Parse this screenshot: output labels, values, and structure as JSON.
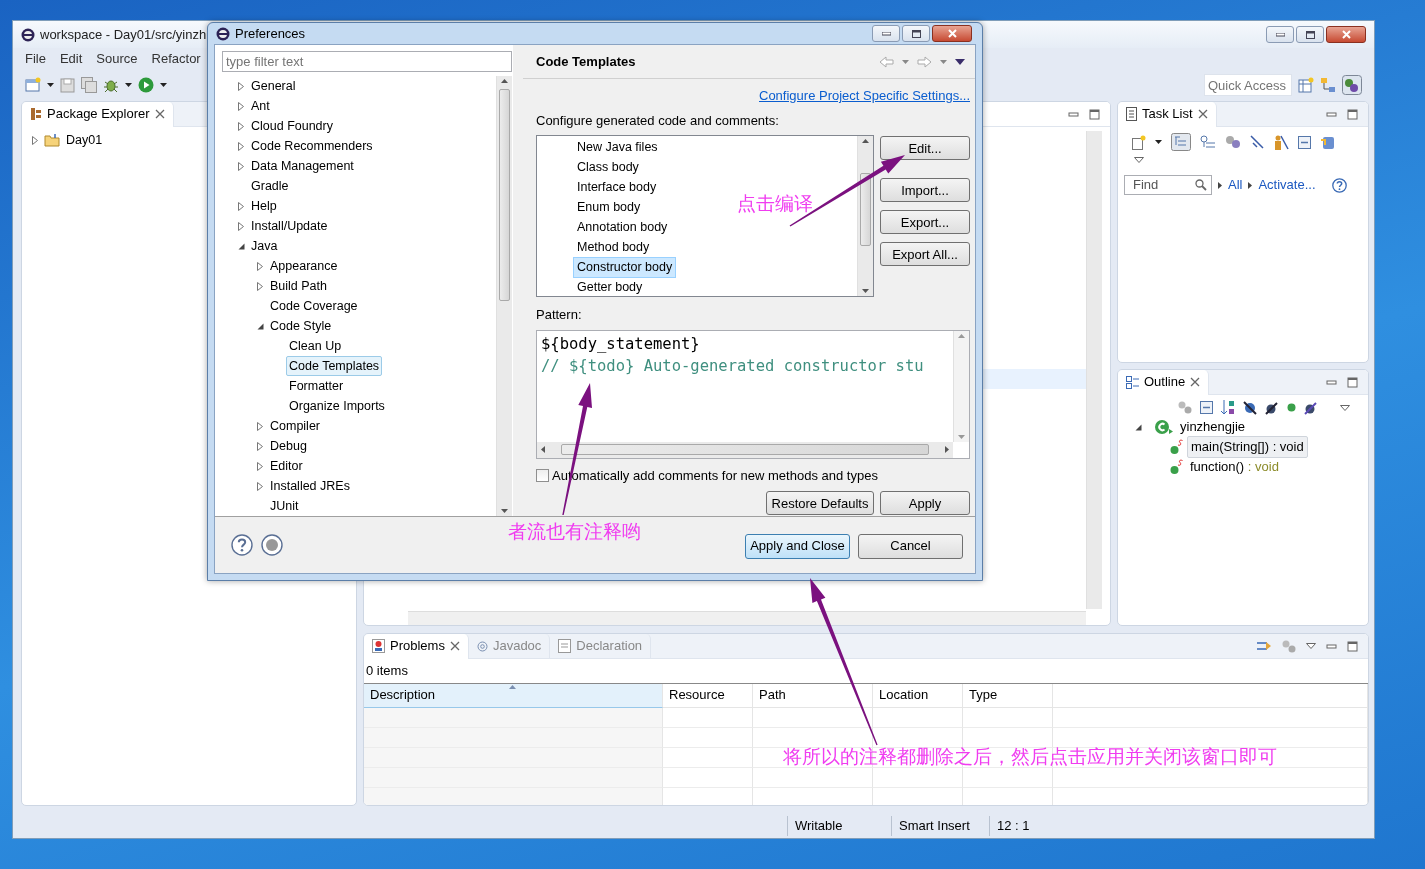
{
  "ide": {
    "title": "workspace - Day01/src/yinzh",
    "menu": [
      "File",
      "Edit",
      "Source",
      "Refactor"
    ],
    "quick_access": {
      "placeholder": "Quick Access"
    },
    "package_explorer": {
      "title": "Package Explorer",
      "items": [
        {
          "label": "Day01",
          "expanded": false
        }
      ]
    },
    "task_list": {
      "title": "Task List",
      "find": {
        "placeholder": "Find"
      },
      "filters": [
        "All",
        "Activate..."
      ]
    },
    "outline": {
      "title": "Outline",
      "items": [
        {
          "label": "yinzhengjie",
          "expanded": true,
          "selected": false,
          "children": [
            {
              "label": "main(String[])",
              "return_type": " : void",
              "selected": true
            },
            {
              "label": "function()",
              "return_type": " : void",
              "selected": false
            }
          ]
        }
      ]
    },
    "problems": {
      "tabs": [
        {
          "label": "Problems",
          "selected": true
        },
        {
          "label": "Javadoc",
          "selected": false
        },
        {
          "label": "Declaration",
          "selected": false
        }
      ],
      "summary": "0 items",
      "columns": [
        {
          "label": "Description",
          "sorted": true
        },
        {
          "label": "Resource",
          "sorted": false
        },
        {
          "label": "Path",
          "sorted": false
        },
        {
          "label": "Location",
          "sorted": false
        },
        {
          "label": "Type",
          "sorted": false
        }
      ]
    },
    "status_bar": [
      "Writable",
      "Smart Insert",
      "12 : 1"
    ]
  },
  "dialog": {
    "title": "Preferences",
    "filter": {
      "placeholder": "type filter text"
    },
    "tree": [
      {
        "label": "General",
        "expanded": false,
        "selected": false
      },
      {
        "label": "Ant",
        "expanded": false,
        "selected": false
      },
      {
        "label": "Cloud Foundry",
        "expanded": false,
        "selected": false
      },
      {
        "label": "Code Recommenders",
        "expanded": false,
        "selected": false
      },
      {
        "label": "Data Management",
        "expanded": false,
        "selected": false
      },
      {
        "label": "Gradle",
        "selected": false
      },
      {
        "label": "Help",
        "expanded": false,
        "selected": false
      },
      {
        "label": "Install/Update",
        "expanded": false,
        "selected": false
      },
      {
        "label": "Java",
        "expanded": true,
        "selected": false,
        "children": [
          {
            "label": "Appearance",
            "expanded": false,
            "selected": false
          },
          {
            "label": "Build Path",
            "expanded": false,
            "selected": false
          },
          {
            "label": "Code Coverage",
            "selected": false
          },
          {
            "label": "Code Style",
            "expanded": true,
            "selected": false,
            "children": [
              {
                "label": "Clean Up",
                "selected": false
              },
              {
                "label": "Code Templates",
                "selected": true
              },
              {
                "label": "Formatter",
                "selected": false
              },
              {
                "label": "Organize Imports",
                "selected": false
              }
            ]
          },
          {
            "label": "Compiler",
            "expanded": false,
            "selected": false
          },
          {
            "label": "Debug",
            "expanded": false,
            "selected": false
          },
          {
            "label": "Editor",
            "expanded": false,
            "selected": false
          },
          {
            "label": "Installed JREs",
            "expanded": false,
            "selected": false
          },
          {
            "label": "JUnit",
            "selected": false
          }
        ]
      }
    ],
    "page_title": "Code Templates",
    "link": "Configure Project Specific Settings...",
    "description": "Configure generated code and comments:",
    "templates": [
      {
        "label": "New Java files",
        "selected": false
      },
      {
        "label": "Class body",
        "selected": false
      },
      {
        "label": "Interface body",
        "selected": false
      },
      {
        "label": "Enum body",
        "selected": false
      },
      {
        "label": "Annotation body",
        "selected": false
      },
      {
        "label": "Method body",
        "selected": false
      },
      {
        "label": "Constructor body",
        "selected": true
      },
      {
        "label": "Getter body",
        "selected": false
      }
    ],
    "template_buttons": [
      "Edit...",
      "Import...",
      "Export...",
      "Export All..."
    ],
    "pattern_label": "Pattern:",
    "pattern": [
      {
        "kind": "code",
        "text": "${body_statement}"
      },
      {
        "kind": "comment",
        "text": "// ${todo} Auto-generated constructor stu"
      }
    ],
    "auto_comments": {
      "label": "Automatically add comments for new methods and types",
      "checked": false
    },
    "page_buttons": [
      "Restore Defaults",
      "Apply"
    ],
    "buttons": [
      {
        "label": "Apply and Close",
        "default": true
      },
      {
        "label": "Cancel",
        "default": false
      }
    ]
  },
  "annotations": [
    {
      "text": "点击编译"
    },
    {
      "text": "者流也有注释哟"
    },
    {
      "text": "将所以的注释都删除之后，然后点击应用并关闭该窗口即可"
    }
  ]
}
